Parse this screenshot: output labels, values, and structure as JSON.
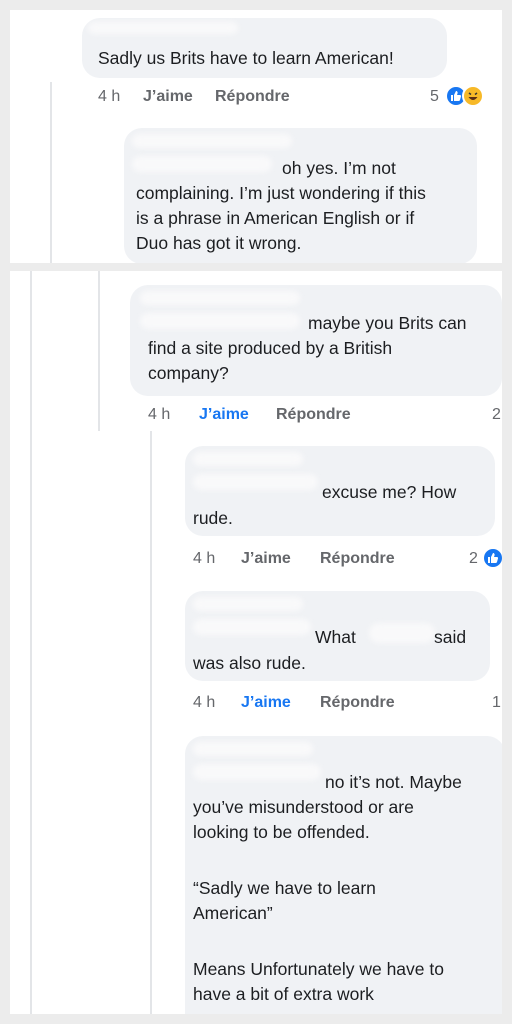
{
  "comments": [
    {
      "text": "Sadly us Brits have to learn American!",
      "time": "4 h",
      "like": "J’aime",
      "reply": "Répondre",
      "reactions": "5",
      "reaction_icons": [
        "like-icon",
        "haha-icon"
      ]
    },
    {
      "lines": [
        "oh yes. I’m not",
        "complaining. I’m just wondering if this",
        "is a phrase in American English or if",
        "Duo has got it wrong."
      ]
    },
    {
      "lines": [
        "maybe you Brits can",
        "find a site produced by a British",
        "company?"
      ],
      "time": "4 h",
      "like": "J’aime",
      "reply": "Répondre",
      "reactions": "2",
      "liked": true
    },
    {
      "lines": [
        "excuse me? How",
        "rude."
      ],
      "time": "4 h",
      "like": "J’aime",
      "reply": "Répondre",
      "reactions": "2",
      "reaction_icons": [
        "like-icon"
      ]
    },
    {
      "lines": [
        "What",
        "said",
        "was also rude."
      ],
      "time": "4 h",
      "like": "J’aime",
      "reply": "Répondre",
      "reactions": "1",
      "liked": true
    },
    {
      "lines": [
        "no it’s not. Maybe",
        "you’ve misunderstood or are",
        "looking to be offended.",
        "",
        "“Sadly we have to learn",
        "American”",
        "",
        "Means Unfortunately we have to",
        "have a bit of extra work"
      ]
    }
  ],
  "colors": {
    "bubble": "#f0f2f5",
    "meta_text": "#65676b",
    "like_blue": "#1877f2",
    "background": "#ececec"
  }
}
